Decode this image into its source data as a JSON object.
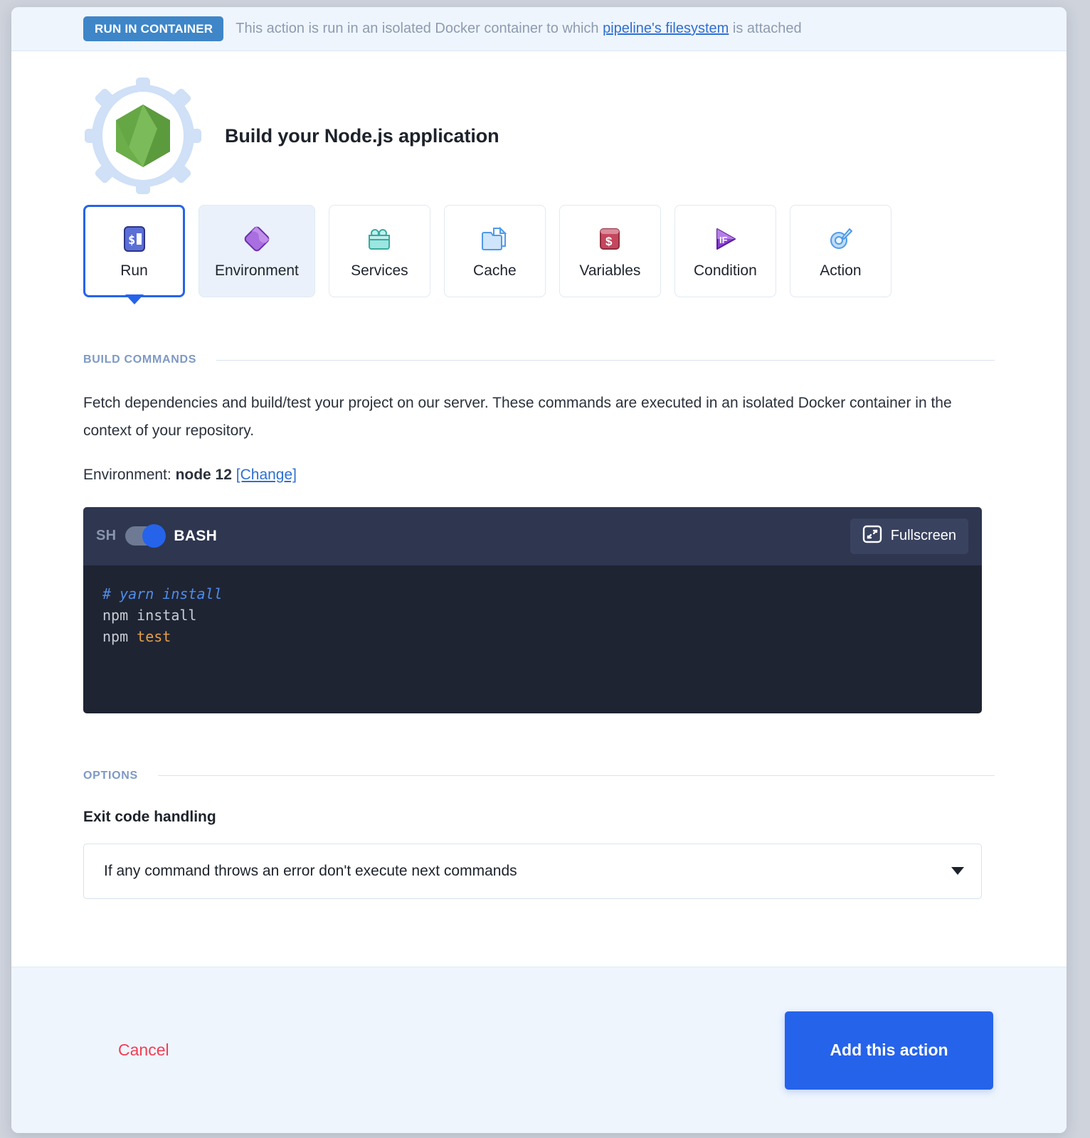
{
  "banner": {
    "badge": "RUN IN CONTAINER",
    "text_before": "This action is run in an isolated Docker container to which ",
    "link": "pipeline's filesystem",
    "text_after": " is attached",
    "badge_color": "#3e86c8",
    "link_color": "#2f6fd0"
  },
  "header": {
    "title": "Build your Node.js application",
    "logo_icon": "nodejs-hexagon-icon"
  },
  "tabs": [
    {
      "label": "Run",
      "icon": "terminal-prompt-icon",
      "state": "active"
    },
    {
      "label": "Environment",
      "icon": "purple-diamond-icon",
      "state": "hover"
    },
    {
      "label": "Services",
      "icon": "services-bag-icon",
      "state": "default"
    },
    {
      "label": "Cache",
      "icon": "cache-files-icon",
      "state": "default"
    },
    {
      "label": "Variables",
      "icon": "variables-card-icon",
      "state": "default"
    },
    {
      "label": "Condition",
      "icon": "if-play-icon",
      "state": "default"
    },
    {
      "label": "Action",
      "icon": "action-gear-icon",
      "state": "default"
    }
  ],
  "build_commands": {
    "section_label": "BUILD COMMANDS",
    "description": "Fetch dependencies and build/test your project on our server. These commands are executed in an isolated Docker container in the context of your repository.",
    "environment_prefix": "Environment: ",
    "environment_value": "node 12",
    "environment_change_link": "[Change]",
    "editor": {
      "shell_off_label": "SH",
      "shell_on_label": "BASH",
      "toggle_state": "on",
      "fullscreen_label": "Fullscreen",
      "fullscreen_icon": "fullscreen-expand-icon",
      "lines": [
        {
          "text": "# yarn install",
          "style": "comment"
        },
        {
          "text": "npm install",
          "style": "plain"
        },
        {
          "text": "npm test",
          "style": "command-orange"
        }
      ],
      "code_comment": "# yarn install",
      "code_line2": "npm install",
      "code_line3_cmd": "npm ",
      "code_line3_arg": "test"
    }
  },
  "options": {
    "section_label": "OPTIONS",
    "field_label": "Exit code handling",
    "select_value": "If any command throws an error don't execute next commands",
    "caret_icon": "chevron-down-icon"
  },
  "footer": {
    "cancel_label": "Cancel",
    "submit_label": "Add this action",
    "cancel_color": "#ef3e56",
    "submit_color": "#2563eb"
  }
}
